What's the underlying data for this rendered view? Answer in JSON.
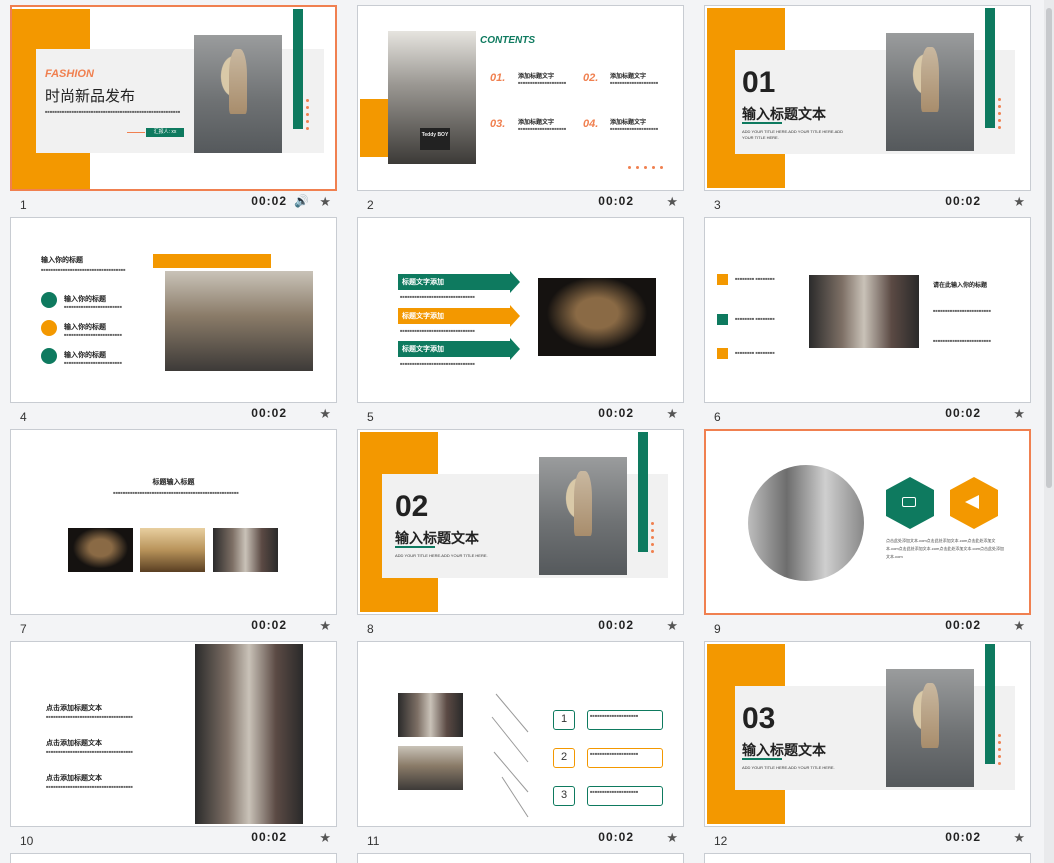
{
  "slides": [
    {
      "number": "1",
      "duration": "00:02",
      "fashion": "FASHION",
      "title": "时尚新品发布",
      "reporter": "汇报人: xx"
    },
    {
      "number": "2",
      "duration": "00:02",
      "contents": "CONTENTS",
      "sign": "Teddy BOY",
      "items": [
        {
          "n": "01.",
          "t": "添加标题文字"
        },
        {
          "n": "02.",
          "t": "添加标题文字"
        },
        {
          "n": "03.",
          "t": "添加标题文字"
        },
        {
          "n": "04.",
          "t": "添加标题文字"
        }
      ]
    },
    {
      "number": "3",
      "duration": "00:02",
      "big": "01",
      "title": "输入标题文本",
      "sub": "ADD YOUR TITLE HERE.ADD YOUR TITLE HERE.ADD YOUR TITLE HERE."
    },
    {
      "number": "4",
      "duration": "00:02",
      "heading": "输入你的标题",
      "items": [
        "输入你的标题",
        "输入你的标题",
        "输入你的标题"
      ]
    },
    {
      "number": "5",
      "duration": "00:02",
      "arrows": [
        "标题文字添加",
        "标题文字添加",
        "标题文字添加"
      ]
    },
    {
      "number": "6",
      "duration": "00:02",
      "heading": "请在此输入你的标题"
    },
    {
      "number": "7",
      "duration": "00:02",
      "heading": "标题输入标题"
    },
    {
      "number": "8",
      "duration": "00:02",
      "big": "02",
      "title": "输入标题文本",
      "sub": "ADD YOUR TITLE HERE.ADD YOUR TITLE HERE."
    },
    {
      "number": "9",
      "duration": "00:02",
      "text": "点击此处添加文本.com点击此处添加文本.com点击此处添加文本.com点击此处添加文本.com点击此处添加文本.com点击此处添加文本.com"
    },
    {
      "number": "10",
      "duration": "00:02",
      "items": [
        "点击添加标题文本",
        "点击添加标题文本",
        "点击添加标题文本"
      ]
    },
    {
      "number": "11",
      "duration": "00:02",
      "steps": [
        "1",
        "2",
        "3"
      ]
    },
    {
      "number": "12",
      "duration": "00:02",
      "big": "03",
      "title": "输入标题文本",
      "sub": "ADD YOUR TITLE HERE.ADD YOUR TITLE HERE."
    }
  ],
  "colors": {
    "orange": "#f39800",
    "green": "#0e7a5f",
    "accent": "#f08050"
  },
  "icons": {
    "star": "★",
    "speaker": "🔊"
  }
}
